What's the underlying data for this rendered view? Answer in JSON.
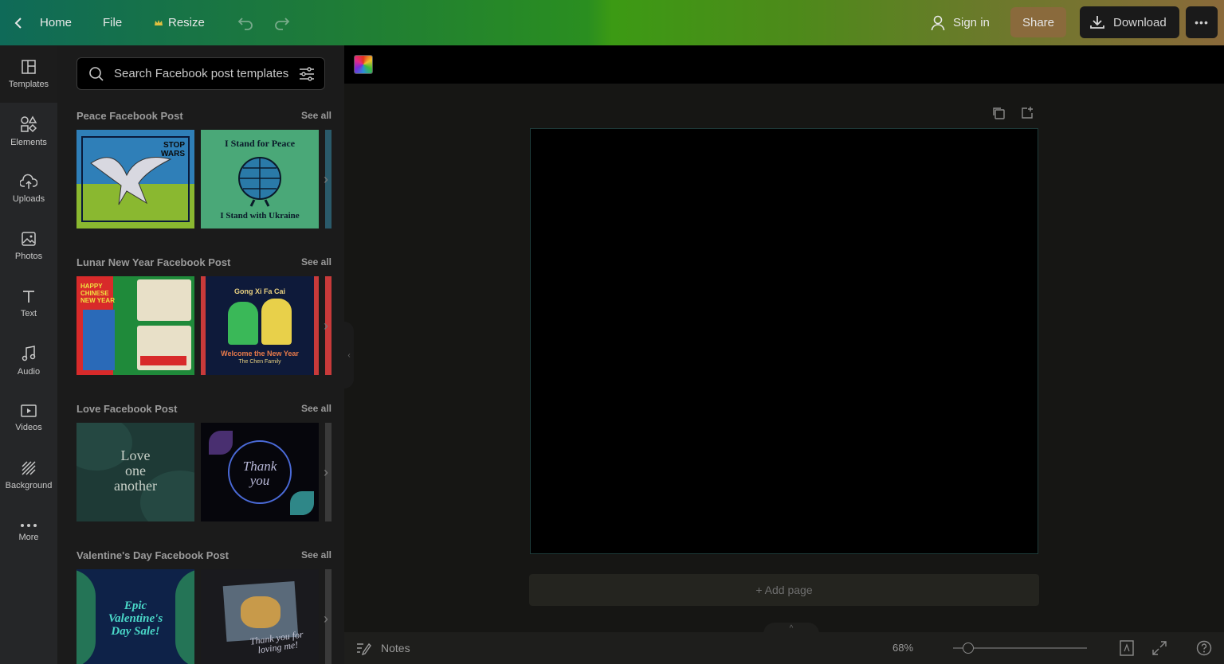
{
  "topbar": {
    "home_label": "Home",
    "file_label": "File",
    "resize_label": "Resize",
    "signin_label": "Sign in",
    "share_label": "Share",
    "download_label": "Download"
  },
  "rail": {
    "items": [
      {
        "label": "Templates",
        "icon": "templates-icon"
      },
      {
        "label": "Elements",
        "icon": "elements-icon"
      },
      {
        "label": "Uploads",
        "icon": "upload-icon"
      },
      {
        "label": "Photos",
        "icon": "photo-icon"
      },
      {
        "label": "Text",
        "icon": "text-icon"
      },
      {
        "label": "Audio",
        "icon": "music-icon"
      },
      {
        "label": "Videos",
        "icon": "video-icon"
      },
      {
        "label": "Background",
        "icon": "background-icon"
      },
      {
        "label": "More",
        "icon": "more-icon"
      }
    ]
  },
  "panel": {
    "search_placeholder": "Search Facebook post templates",
    "sections": [
      {
        "title": "Peace Facebook Post",
        "see_all": "See all",
        "thumbs": [
          {
            "lines": [
              "STOP",
              "WARS"
            ]
          },
          {
            "top": "I Stand for Peace",
            "bottom": "I Stand with Ukraine"
          }
        ]
      },
      {
        "title": "Lunar New Year Facebook Post",
        "see_all": "See all",
        "thumbs": [
          {
            "lines": [
              "HAPPY",
              "CHINESE",
              "NEW YEAR"
            ]
          },
          {
            "top": "Gong Xi Fa Cai",
            "bottom": "Welcome the New Year",
            "sub": "The Chen Family"
          }
        ]
      },
      {
        "title": "Love Facebook Post",
        "see_all": "See all",
        "thumbs": [
          {
            "lines": [
              "Love",
              "one",
              "another"
            ]
          },
          {
            "lines": [
              "Thank",
              "you"
            ]
          }
        ]
      },
      {
        "title": "Valentine's Day Facebook Post",
        "see_all": "See all",
        "thumbs": [
          {
            "lines": [
              "Epic",
              "Valentine's",
              "Day Sale!"
            ]
          },
          {
            "lines": [
              "Thank you for",
              "loving me!"
            ]
          }
        ]
      }
    ]
  },
  "canvas": {
    "add_page_label": "+ Add page"
  },
  "bottombar": {
    "notes_label": "Notes",
    "zoom_label": "68%",
    "zoom_level": 0.68
  },
  "colors": {
    "accent_share": "#8a6a3c",
    "page_border": "#1e3b3a"
  }
}
